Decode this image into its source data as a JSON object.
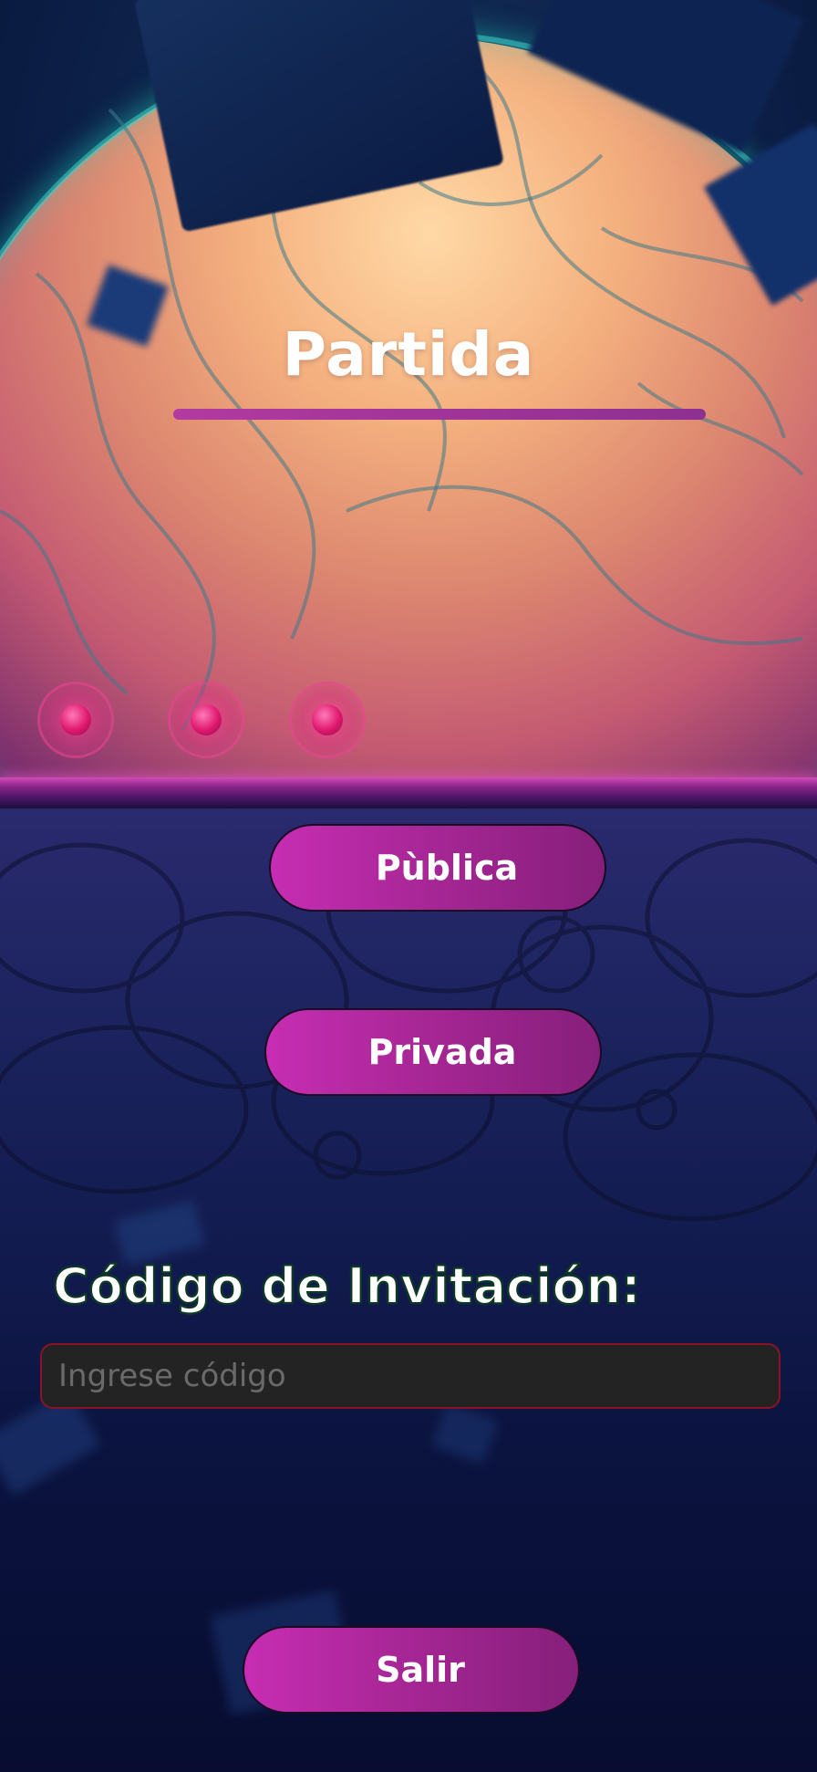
{
  "screen": {
    "title": "Partida",
    "colors": {
      "accent": "#b23aa0",
      "button_gradient_start": "#c72db3",
      "button_gradient_end": "#861f7b",
      "input_border": "#8a1424",
      "input_bg": "#232323"
    }
  },
  "indicators": {
    "count": 3,
    "icon": "glowing-dot-icon"
  },
  "buttons": {
    "public_label": "Pùblica",
    "private_label": "Privada",
    "exit_label": "Salir"
  },
  "invitation": {
    "label": "Código de Invitación:",
    "placeholder": "Ingrese código",
    "value": ""
  }
}
